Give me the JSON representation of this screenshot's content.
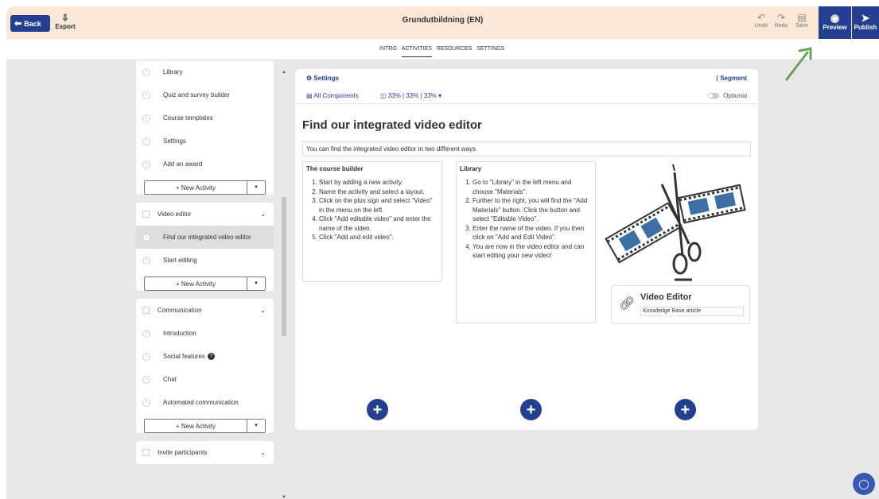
{
  "topbar": {
    "back_label": "Back",
    "export_label": "Export",
    "title": "Grundutbildning (EN)",
    "undo_label": "Undo",
    "redo_label": "Redo",
    "save_label": "Save",
    "preview_label": "Preview",
    "publish_label": "Publish",
    "colors": {
      "bar": "#fbe7d8",
      "brand": "#243f8f"
    }
  },
  "tabs": [
    {
      "label": "INTRO",
      "active": false
    },
    {
      "label": "ACTIVITIES",
      "active": true
    },
    {
      "label": "RESOURCES",
      "active": false
    },
    {
      "label": "SETTINGS",
      "active": false
    }
  ],
  "sidebar": {
    "group1": {
      "items": [
        "Library",
        "Quiz and survey builder",
        "Course templates",
        "Settings",
        "Add an award"
      ],
      "new_activity": "+ New Activity"
    },
    "group2": {
      "title": "Video editor",
      "items": [
        "Find our integrated video editor",
        "Start editing"
      ],
      "selected_index": 0,
      "new_activity": "+ New Activity"
    },
    "group3": {
      "title": "Communication",
      "items": [
        "Introduction",
        "Social features",
        "Chat",
        "Automated communication"
      ],
      "new_activity": "+ New Activity"
    },
    "group4": {
      "title": "Invite participants"
    }
  },
  "canvas": {
    "settings_label": "Settings",
    "segment_label": "Segment",
    "all_components_label": "All Components",
    "layout_label": "33% | 33% | 33%",
    "optional_label": "Optional",
    "heading": "Find our integrated video editor",
    "intro_text": "You can find the integrated video editor in two different ways.",
    "col1": {
      "title": "The course builder",
      "steps": [
        "Start by adding a new activity.",
        "Name the activity and select a layout.",
        "Click on the plus sign and select \"Video\" in the menu on the left.",
        "Click \"Add editable video\" and enter the name of the video.",
        "Click \"Add and edit video\"."
      ]
    },
    "col2": {
      "title": "Library",
      "steps": [
        "Go to \"Library\" in the left menu and choose \"Materials\".",
        "Further to the right, you will find the \"Add Materials\" button. Click the button and select \"Editable Video\".",
        "Enter the name of the video. If you then click on \"Add and Edit Video\".",
        "You are now in the video editor and can start editing your new video!"
      ]
    },
    "link_card": {
      "title": "Video Editor",
      "subtitle": "Knowledge Base article"
    }
  },
  "icons": {
    "back": "arrow-left-icon",
    "export": "download-icon",
    "undo": "undo-icon",
    "redo": "redo-icon",
    "save": "save-icon",
    "preview": "eye-icon",
    "publish": "rocket-icon",
    "chat": "chat-bubble-icon"
  }
}
